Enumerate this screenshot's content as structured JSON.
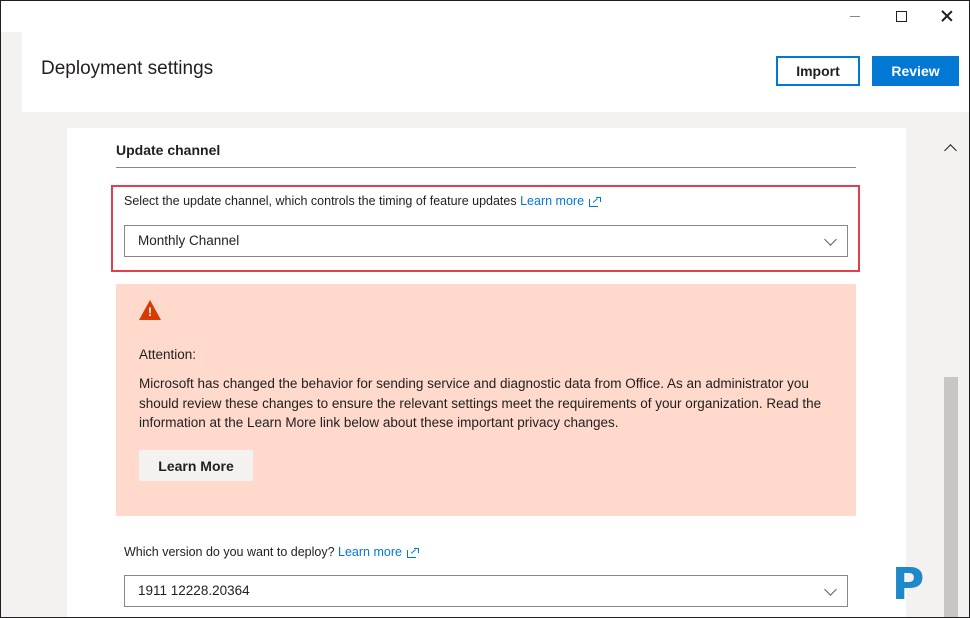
{
  "window": {
    "controls": {
      "minimize_icon": "minimize-icon",
      "maximize_icon": "maximize-icon",
      "close_icon": "close-icon"
    }
  },
  "header": {
    "title": "Deployment settings",
    "import_label": "Import",
    "review_label": "Review"
  },
  "update_channel": {
    "section_title": "Update channel",
    "field_label": "Select the update channel, which controls the timing of feature updates",
    "learn_more": "Learn more",
    "selected_value": "Monthly Channel"
  },
  "warning": {
    "icon": "warning-icon",
    "icon_glyph": "!",
    "title": "Attention:",
    "body": "Microsoft has changed the behavior for sending service and diagnostic data from Office. As an administrator you should review these changes to ensure the relevant settings meet the requirements of your organization. Read the information at the Learn More link below about these important privacy changes.",
    "button_label": "Learn More"
  },
  "version": {
    "field_label": "Which version do you want to deploy?",
    "learn_more": "Learn more",
    "selected_value": "1911 12228.20364"
  },
  "colors": {
    "accent": "#0078d4",
    "highlight_border": "#e0404d",
    "warning_background": "#fed9cc",
    "warning_icon": "#d83b01"
  }
}
